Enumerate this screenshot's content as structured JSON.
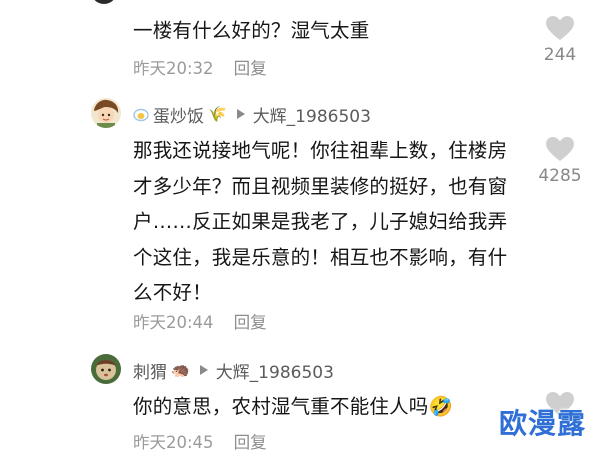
{
  "comments": [
    {
      "text": "一楼有什么好的？湿气太重",
      "time": "昨天20:32",
      "reply_label": "回复",
      "likes": "244"
    },
    {
      "username": "蛋炒饭",
      "username_emoji": "🌾",
      "reply_to": "大辉_1986503",
      "text": "那我还说接地气呢！你往祖辈上数，住楼房才多少年？而且视频里装修的挺好，也有窗户……反正如果是我老了，儿子媳妇给我弄个这住，我是乐意的！相互也不影响，有什么不好！",
      "time": "昨天20:44",
      "reply_label": "回复",
      "likes": "4285"
    },
    {
      "username": "刺猬",
      "username_emoji": "🦔",
      "reply_to": "大辉_1986503",
      "text": "你的意思，农村湿气重不能住人吗🤣",
      "time": "昨天20:45",
      "reply_label": "回复",
      "likes": ""
    }
  ],
  "watermark": "欧漫露",
  "colors": {
    "text": "#161616",
    "meta": "#9b9b9b",
    "heart": "#cfcfcf",
    "watermark": "#2f6fd6"
  }
}
